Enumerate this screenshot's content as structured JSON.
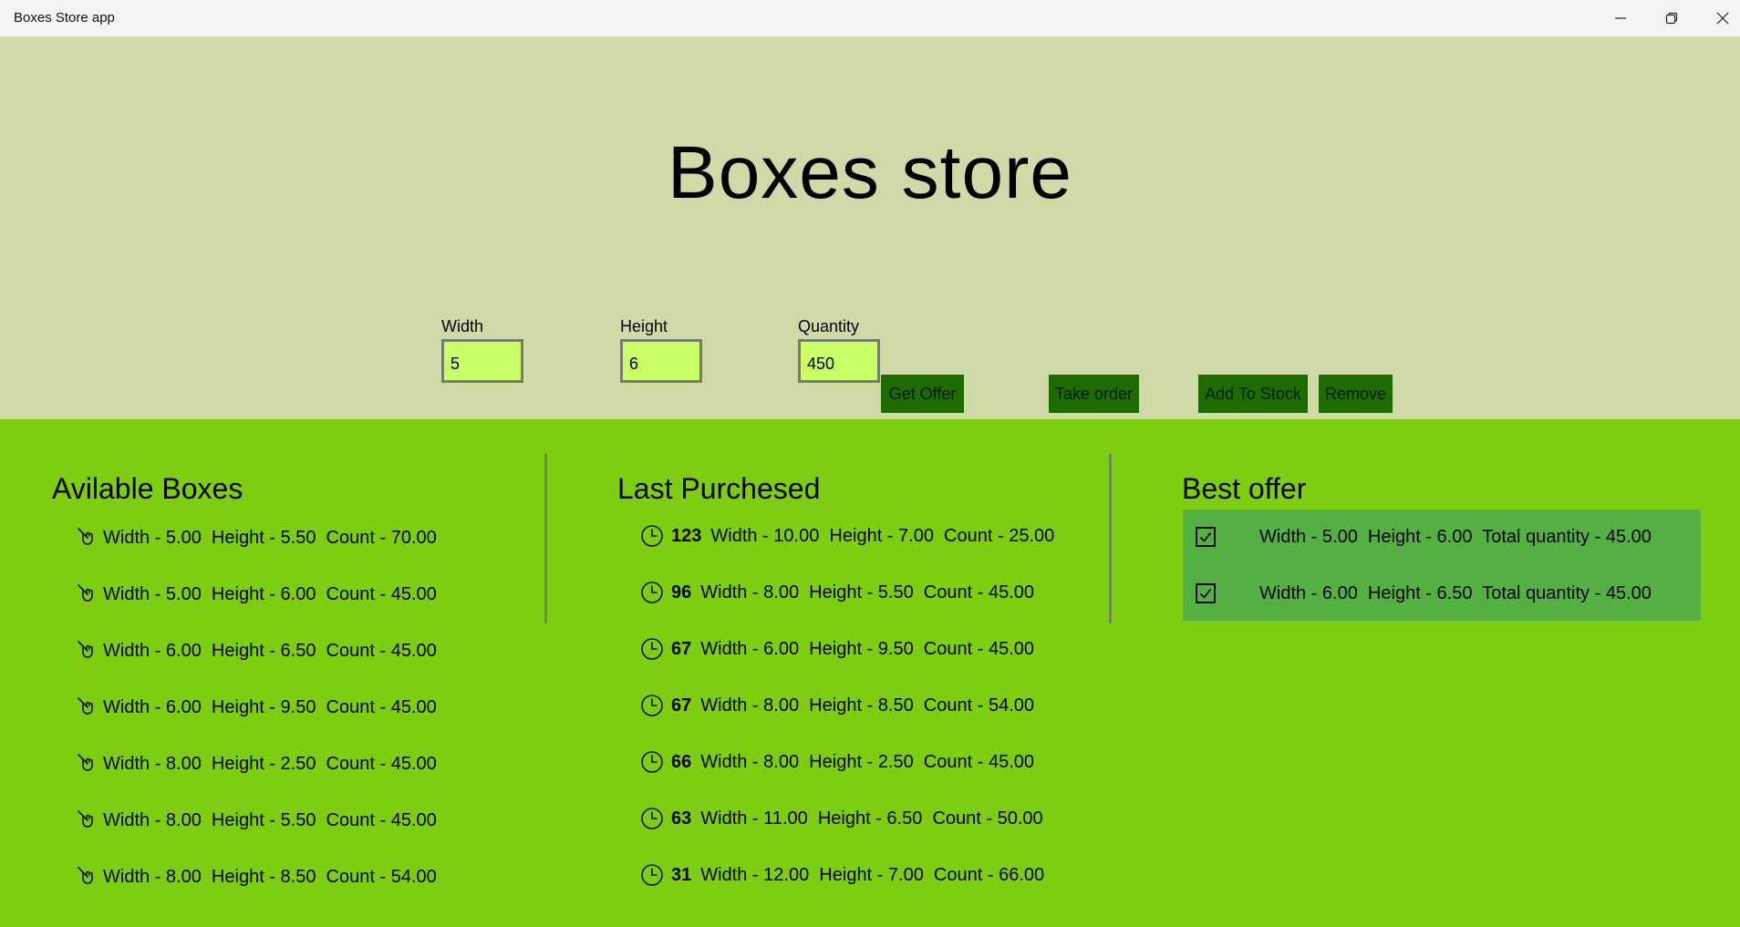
{
  "window": {
    "title": "Boxes Store app",
    "controls": [
      "minimize",
      "restore",
      "close"
    ]
  },
  "header": {
    "title": "Boxes store"
  },
  "form": {
    "width_label": "Width",
    "width_value": "5",
    "height_label": "Height",
    "height_value": "6",
    "quantity_label": "Quantity",
    "quantity_value": "450",
    "get_offer_label": "Get Offer",
    "take_order_label": "Take order",
    "add_to_stock_label": "Add To Stock",
    "remove_label": "Remove"
  },
  "available": {
    "title": "Avilable Boxes",
    "icon": "hand-cursor-icon",
    "items": [
      {
        "text": "Width - 5.00  Height - 5.50  Count - 70.00"
      },
      {
        "text": "Width - 5.00  Height - 6.00  Count - 45.00"
      },
      {
        "text": "Width - 6.00  Height - 6.50  Count - 45.00"
      },
      {
        "text": "Width - 6.00  Height - 9.50  Count - 45.00"
      },
      {
        "text": "Width - 8.00  Height - 2.50  Count - 45.00"
      },
      {
        "text": "Width - 8.00  Height - 5.50  Count - 45.00"
      },
      {
        "text": "Width - 8.00  Height - 8.50  Count - 54.00"
      }
    ]
  },
  "purchased": {
    "title": "Last Purchesed",
    "icon": "clock-icon",
    "items": [
      {
        "num": "123",
        "text": "Width - 10.00  Height - 7.00  Count - 25.00"
      },
      {
        "num": "96",
        "text": "Width - 8.00  Height - 5.50  Count - 45.00"
      },
      {
        "num": "67",
        "text": "Width - 6.00  Height - 9.50  Count - 45.00"
      },
      {
        "num": "67",
        "text": "Width - 8.00  Height - 8.50  Count - 54.00"
      },
      {
        "num": "66",
        "text": "Width - 8.00  Height - 2.50  Count - 45.00"
      },
      {
        "num": "63",
        "text": "Width - 11.00  Height - 6.50  Count - 50.00"
      },
      {
        "num": "31",
        "text": "Width - 12.00  Height - 7.00  Count - 66.00"
      }
    ]
  },
  "offer": {
    "title": "Best offer",
    "icon": "checkbox-checked-icon",
    "items": [
      {
        "text": "Width - 5.00  Height - 6.00  Total quantity - 45.00",
        "checked": true
      },
      {
        "text": "Width - 6.00  Height - 6.50  Total quantity - 45.00",
        "checked": true
      }
    ]
  },
  "colors": {
    "header_bg": "#d0d9a8",
    "content_bg": "#7dcd13",
    "input_bg": "#c9ff66",
    "button_bg": "#1e6b00",
    "offer_panel_bg": "#55b043"
  }
}
